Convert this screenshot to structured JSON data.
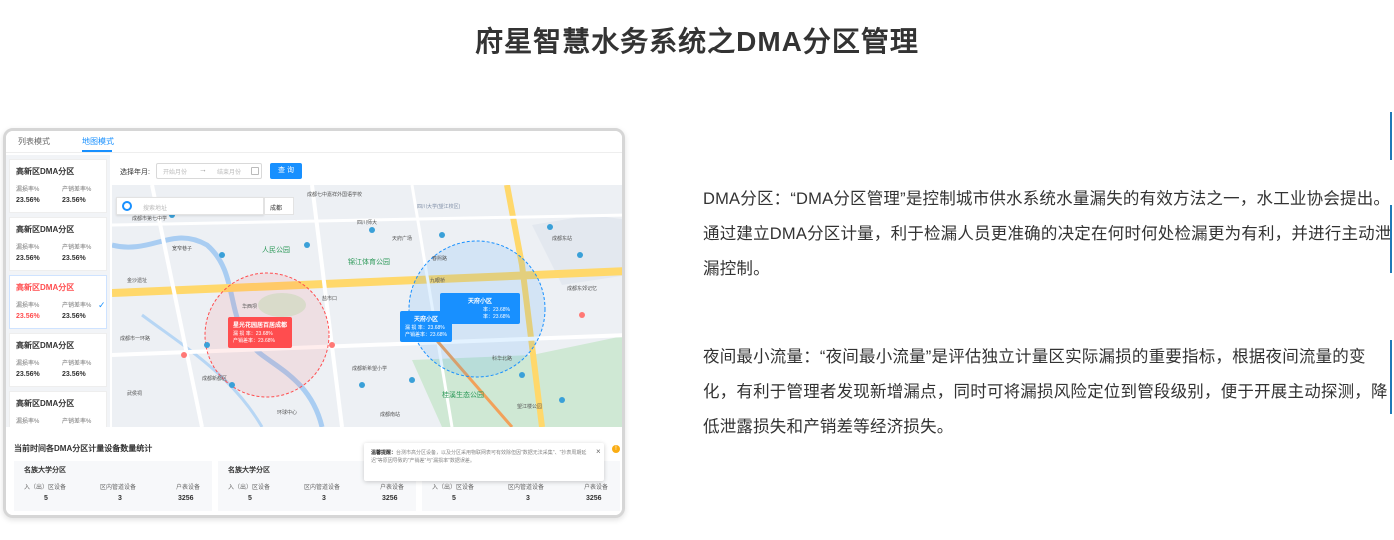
{
  "page": {
    "title": "府星智慧水务系统之DMA分区管理"
  },
  "screenshot": {
    "tabs": [
      {
        "label": "列表模式",
        "active": false
      },
      {
        "label": "地图模式",
        "active": true
      }
    ],
    "sidebar": {
      "items": [
        {
          "name": "高新区DMA分区",
          "k1": "漏损率%",
          "k2": "产销差率%",
          "v1": "23.56%",
          "v2": "23.56%",
          "active": false
        },
        {
          "name": "高新区DMA分区",
          "k1": "漏损率%",
          "k2": "产销差率%",
          "v1": "23.56%",
          "v2": "23.56%",
          "active": false
        },
        {
          "name": "高新区DMA分区",
          "k1": "漏损率%",
          "k2": "产销差率%",
          "v1": "23.56%",
          "v2": "23.56%",
          "active": true
        },
        {
          "name": "高新区DMA分区",
          "k1": "漏损率%",
          "k2": "产销差率%",
          "v1": "23.56%",
          "v2": "23.56%",
          "active": false
        },
        {
          "name": "高新区DMA分区",
          "k1": "漏损率%",
          "k2": "产销差率%",
          "v1": "",
          "v2": "",
          "active": false
        }
      ]
    },
    "filter": {
      "label": "选择年月:",
      "start_placeholder": "开始月份",
      "separator": "→",
      "end_placeholder": "结束月份",
      "query_label": "查 询"
    },
    "map": {
      "search_placeholder": "搜索地址",
      "city": "成都",
      "labels": [
        "锦江体育公园",
        "四川大学(望江校区)",
        "华西坝",
        "成都七中嘉祥外国语学校",
        "四川师大",
        "天府广场",
        "人民公园",
        "成都市第七中学",
        "春熙路",
        "成都东站",
        "成都新希望小学",
        "成都新都区",
        "宽窄巷子",
        "盐市口",
        "九眼桥",
        "科华北路",
        "桂溪生态公园",
        "成都东郊记忆",
        "望江楼公园",
        "成都市一环路",
        "环球中心",
        "成都南站",
        "武侯祠",
        "金沙遗址"
      ],
      "popups": [
        {
          "title": "星光花园居百居成都",
          "rows": [
            "漏 损 率：23.68%",
            "产销差率：23.68%"
          ],
          "color": "red"
        },
        {
          "title": "天府小区",
          "rows": [
            "漏 损 率：23.68%",
            "产销差率：23.68%"
          ],
          "color": "blue"
        },
        {
          "title": "天府小区",
          "rows": [
            "率：23.68%",
            "率：23.68%"
          ],
          "color": "blue"
        }
      ]
    },
    "stats": {
      "title": "当前时间各DMA分区计量设备数量统计",
      "cards": [
        {
          "name": "名族大学分区",
          "keys": [
            "入（出）区设备",
            "区内管道设备",
            "户表设备"
          ],
          "values": [
            "5",
            "3",
            "3256"
          ]
        },
        {
          "name": "名族大学分区",
          "keys": [
            "入（出）区设备",
            "区内管道设备",
            "户表设备"
          ],
          "values": [
            "5",
            "3",
            "3256"
          ]
        },
        {
          "name": "",
          "keys": [
            "入（出）区设备",
            "区内管道设备",
            "户表设备"
          ],
          "values": [
            "5",
            "3",
            "3256"
          ]
        }
      ],
      "tip": {
        "title": "温馨提醒：",
        "text": "台测市高分区设备，以及分区采用物联网表可有效除但因\"数据无法采集\"、\"抄表周期延迟\"等原因导致的\"产销差\"与\"漏损率\"数据误差。",
        "close": "×",
        "warn": "!"
      }
    }
  },
  "description": {
    "p1": "DMA分区：“DMA分区管理”是控制城市供水系统水量漏失的有效方法之一，水工业协会提出。通过建立DMA分区计量，利于检漏人员更准确的决定在何时何处检漏更为有利，并进行主动泄漏控制。",
    "p2": "夜间最小流量：“夜间最小流量”是评估独立计量区实际漏损的重要指标，根据夜间流量的变化，有利于管理者发现新增漏点，同时可将漏损风险定位到管段级别，便于开展主动探测，降低泄露损失和产销差等经济损失。"
  },
  "colors": {
    "accent": "#1890ff",
    "alert": "#ff4d4f",
    "side_line": "#1f7ab8"
  }
}
